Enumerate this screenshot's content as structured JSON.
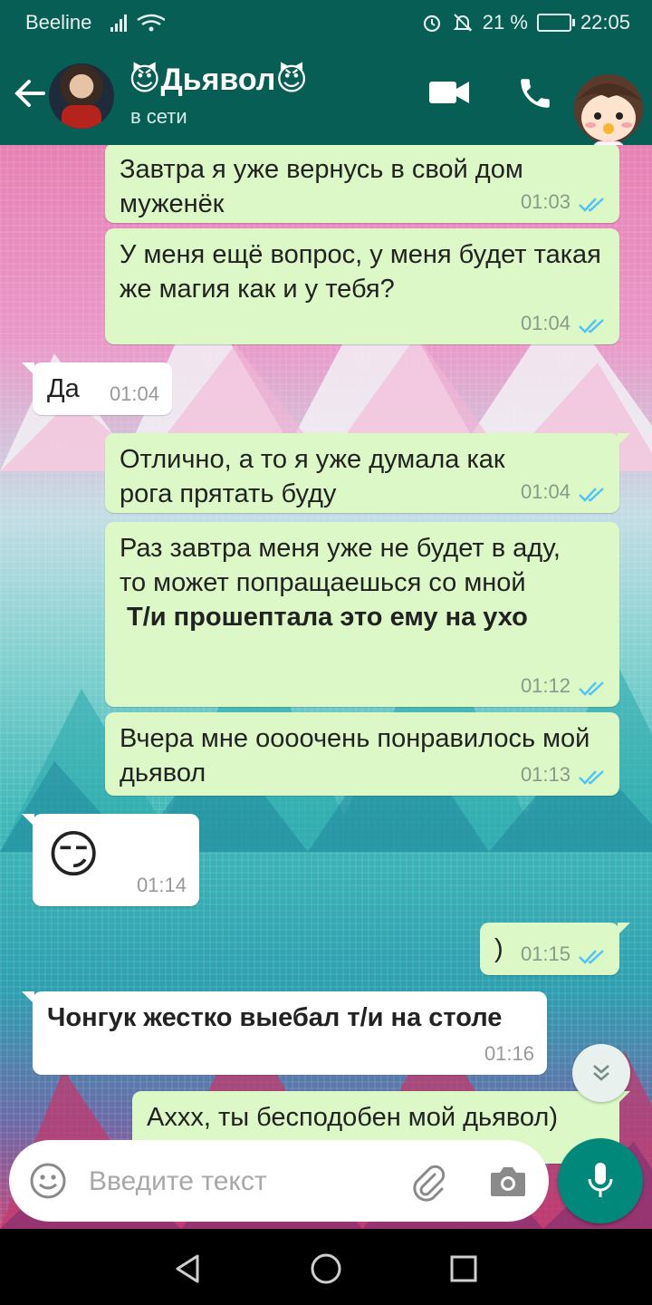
{
  "status_bar": {
    "carrier": "Beeline",
    "battery": "21 %",
    "time": "22:05"
  },
  "header": {
    "name": "😈Дьявол😈",
    "status": "в сети"
  },
  "messages": [
    {
      "dir": "out",
      "text": "Завтра я уже вернусь в свой дом муженёк",
      "time": "01:03",
      "read": true
    },
    {
      "dir": "out",
      "text": "У меня ещё вопрос, у меня будет такая же магия как и у тебя?",
      "time": "01:04",
      "read": true
    },
    {
      "dir": "in",
      "text": "Да",
      "time": "01:04"
    },
    {
      "dir": "out",
      "text": "Отлично, а то я уже думала как рога прятать буду",
      "time": "01:04",
      "read": true
    },
    {
      "dir": "out",
      "text": "Раз завтра меня уже не будет в аду, то может попращаешься со мной",
      "text2": "Т/и прошептала это ему на ухо",
      "time": "01:12",
      "read": true
    },
    {
      "dir": "out",
      "text": "Вчера мне оооочень понравилось мой дьявол",
      "time": "01:13",
      "read": true
    },
    {
      "dir": "in",
      "text": "😏",
      "time": "01:14"
    },
    {
      "dir": "out",
      "text": ")",
      "time": "01:15",
      "read": true
    },
    {
      "dir": "in",
      "text": "Чонгук жестко выебал т/и на столе",
      "time": "01:16"
    },
    {
      "dir": "out",
      "text": "Аххх, ты бесподобен мой дьявол)",
      "time": ""
    }
  ],
  "input": {
    "placeholder": "Введите текст",
    "value": ""
  },
  "colors": {
    "header": "#075e54",
    "outgoing": "#dcf8c6",
    "incoming": "#ffffff",
    "tick": "#4fc3f7",
    "mic": "#00897b"
  }
}
